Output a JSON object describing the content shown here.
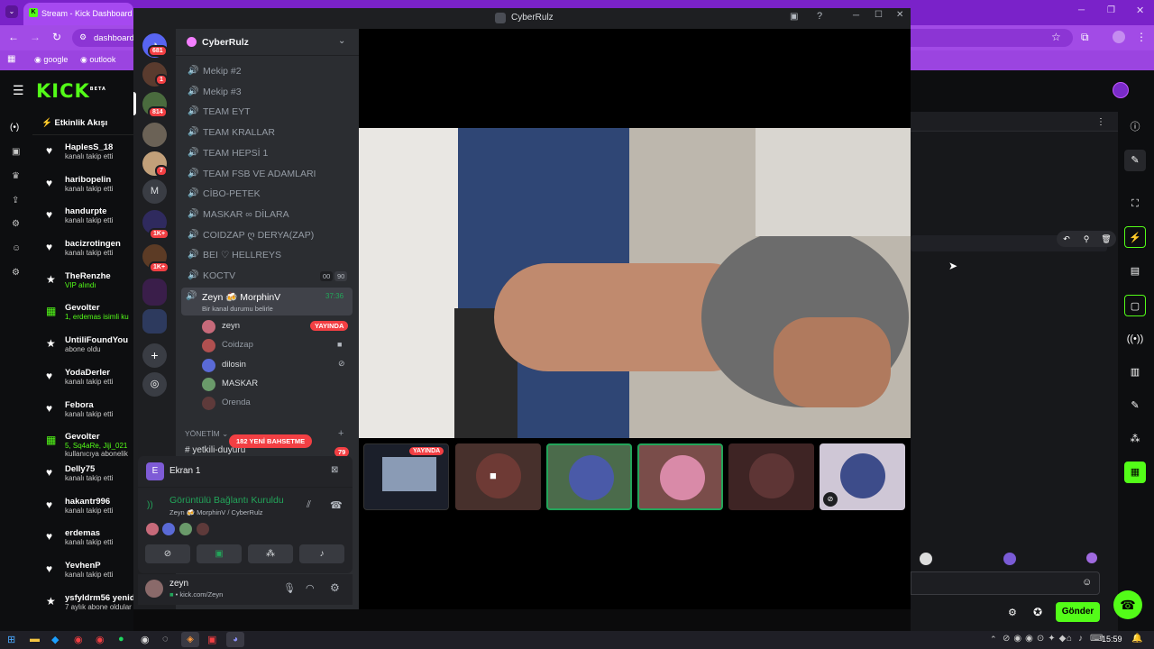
{
  "browser": {
    "tab_title": "Stream - Kick Dashboard",
    "address": "dashboard",
    "bookmarks": [
      "google",
      "outlook"
    ]
  },
  "kick": {
    "logo": "KICK",
    "logo_sup": "BETA",
    "feed_title": "Etkinlik Akışı",
    "send_label": "Gönder",
    "feed": [
      {
        "user": "HaplesS_18",
        "sub": "kanalı takip etti",
        "icon": "heart-icon"
      },
      {
        "user": "haribopelin",
        "sub": "kanalı takip etti",
        "icon": "heart-icon"
      },
      {
        "user": "handurpte",
        "sub": "kanalı takip etti",
        "icon": "heart-icon"
      },
      {
        "user": "bacizrotingen",
        "sub": "kanalı takip etti",
        "icon": "heart-icon"
      },
      {
        "user": "TheRenzhe",
        "sub": "VIP alındı",
        "icon": "star-icon"
      },
      {
        "user": "Gevolter",
        "sub": "1, erdemas isimli ku",
        "icon": "gift-icon"
      },
      {
        "user": "UntiliFoundYou",
        "sub": "abone oldu",
        "icon": "star-icon"
      },
      {
        "user": "YodaDerler",
        "sub": "kanalı takip etti",
        "icon": "heart-icon"
      },
      {
        "user": "Febora",
        "sub": "kanalı takip etti",
        "icon": "heart-icon"
      },
      {
        "user": "Gevolter",
        "sub": "5, Sq4aRe, Jiji_021",
        "sub2": "kullanıcıya abonelik",
        "icon": "gift-icon"
      },
      {
        "user": "Delly75",
        "sub": "kanalı takip etti",
        "icon": "heart-icon"
      },
      {
        "user": "hakantr996",
        "sub": "kanalı takip etti",
        "icon": "heart-icon"
      },
      {
        "user": "erdemas",
        "sub": "kanalı takip etti",
        "icon": "heart-icon"
      },
      {
        "user": "YevhenP",
        "sub": "kanalı takip etti",
        "icon": "heart-icon"
      },
      {
        "user": "ysfyldrm56 yeniden abone oldu.",
        "sub": "7 aylık abone oldular",
        "icon": "star-icon"
      }
    ]
  },
  "discord": {
    "window_title": "CyberRulz",
    "server_name": "CyberRulz",
    "server_badges": [
      "681",
      "1",
      "814",
      "7",
      "1K+",
      "1K+"
    ],
    "server_letter": "M",
    "channels": [
      "Mekip #2",
      "Mekip #3",
      "TEAM EYT",
      "TEAM KRALLAR",
      "TEAM HEPSİ 1",
      "TEAM FSB VE ADAMLARI",
      "CİBO-PETEK",
      "MASKAR ∞ DİLARA",
      "COIDZAP ღ DERYA(ZAP)",
      "BEI ♡ HELLREYS",
      "KOCTV"
    ],
    "koctv_counts": [
      "00",
      "90"
    ],
    "active_channel": {
      "name": "Zeyn 🍻 MorphinV",
      "time": "37:36",
      "status": "Bir kanal durumu belirle"
    },
    "voice_users": [
      {
        "name": "zeyn",
        "badge": "YAYINDA"
      },
      {
        "name": "Coidzap"
      },
      {
        "name": "dilosin"
      },
      {
        "name": "MASKAR"
      },
      {
        "name": "Orenda"
      }
    ],
    "category": "YÖNETİM",
    "next_channel": "yetkili-duyuru",
    "next_badge": "79",
    "bet_pill": "182 YENİ BAHSETME",
    "screen_label": "Ekran 1",
    "connection_title": "Görüntülü Bağlantı Kuruldu",
    "connection_sub": "Zeyn 🍻 MorphinV / CyberRulz",
    "user_name": "zeyn",
    "user_sub": "• kick.com/Zeyn",
    "live_label": "YAYINDA"
  },
  "taskbar": {
    "time": "15:59"
  },
  "colors": {
    "kick_green": "#53fc18",
    "discord_red": "#f23f43",
    "browser_purple": "#a24be6"
  }
}
